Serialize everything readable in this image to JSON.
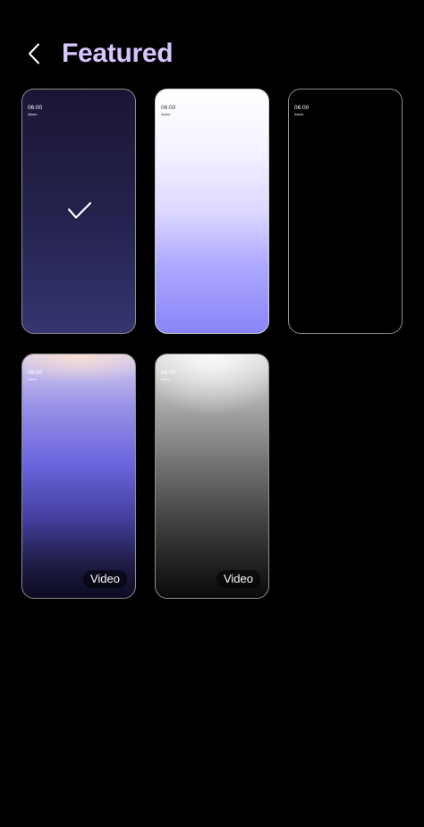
{
  "header": {
    "title": "Featured"
  },
  "colors": {
    "title": "#d8c3ff",
    "background": "#000000"
  },
  "wallpapers": [
    {
      "time": "06:00",
      "sub": "Alarm",
      "selected": true,
      "badge": ""
    },
    {
      "time": "06:00",
      "sub": "Alarm",
      "selected": false,
      "badge": ""
    },
    {
      "time": "06:00",
      "sub": "Alarm",
      "selected": false,
      "badge": ""
    },
    {
      "time": "06:00",
      "sub": "Alarm",
      "selected": false,
      "badge": "Video"
    },
    {
      "time": "06:00",
      "sub": "Alarm",
      "selected": false,
      "badge": "Video"
    }
  ],
  "icons": {
    "back": "chevron-left-icon",
    "selected": "checkmark-icon"
  }
}
